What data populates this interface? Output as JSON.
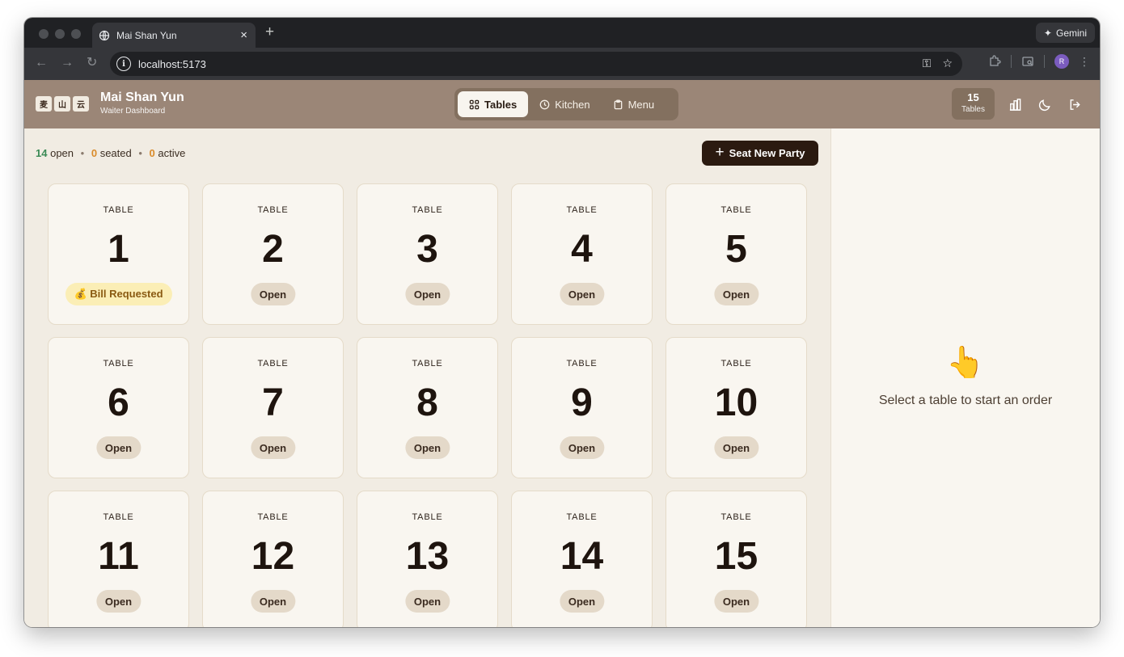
{
  "browser": {
    "tab_title": "Mai Shan Yun",
    "tab_close": "×",
    "new_tab": "+",
    "gemini_label": "Gemini",
    "url": "localhost:5173",
    "profile_initial": "R"
  },
  "header": {
    "seals": [
      "麦",
      "山",
      "云"
    ],
    "brand_name": "Mai Shan Yun",
    "brand_sub": "Waiter Dashboard",
    "nav": [
      {
        "label": "Tables",
        "icon": "grid-icon",
        "active": true
      },
      {
        "label": "Kitchen",
        "icon": "clock-icon",
        "active": false
      },
      {
        "label": "Menu",
        "icon": "clipboard-icon",
        "active": false
      }
    ],
    "table_count": "15",
    "table_count_label": "Tables"
  },
  "status": {
    "open_count": "14",
    "open_label": "open",
    "seated_count": "0",
    "seated_label": "seated",
    "active_count": "0",
    "active_label": "active",
    "separator": "•"
  },
  "seat_button": "Seat New Party",
  "table_label": "TABLE",
  "tables": [
    {
      "number": "1",
      "status": "💰 Bill Requested",
      "kind": "bill"
    },
    {
      "number": "2",
      "status": "Open",
      "kind": "open"
    },
    {
      "number": "3",
      "status": "Open",
      "kind": "open"
    },
    {
      "number": "4",
      "status": "Open",
      "kind": "open"
    },
    {
      "number": "5",
      "status": "Open",
      "kind": "open"
    },
    {
      "number": "6",
      "status": "Open",
      "kind": "open"
    },
    {
      "number": "7",
      "status": "Open",
      "kind": "open"
    },
    {
      "number": "8",
      "status": "Open",
      "kind": "open"
    },
    {
      "number": "9",
      "status": "Open",
      "kind": "open"
    },
    {
      "number": "10",
      "status": "Open",
      "kind": "open"
    },
    {
      "number": "11",
      "status": "Open",
      "kind": "open"
    },
    {
      "number": "12",
      "status": "Open",
      "kind": "open"
    },
    {
      "number": "13",
      "status": "Open",
      "kind": "open"
    },
    {
      "number": "14",
      "status": "Open",
      "kind": "open"
    },
    {
      "number": "15",
      "status": "Open",
      "kind": "open"
    }
  ],
  "side_panel": {
    "emoji": "👆",
    "message": "Select a table to start an order"
  },
  "colors": {
    "header_bg": "#9b8677",
    "accent_dark": "#2b1a10",
    "open_green": "#3a8a55",
    "count_orange": "#d98b2b",
    "bill_badge": "#fbeeb6"
  }
}
